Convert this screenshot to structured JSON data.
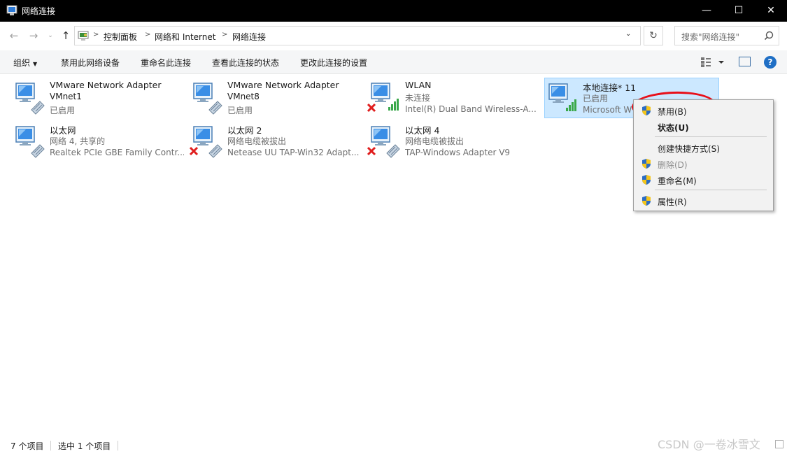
{
  "window": {
    "title": "网络连接",
    "minimize": "—",
    "maximize": "☐",
    "close": "✕"
  },
  "nav": {
    "back": "←",
    "forward": "→",
    "recent": "⌄",
    "up": "↑",
    "refresh": "↻",
    "dropdown": "⌄"
  },
  "breadcrumb": [
    "控制面板",
    "网络和 Internet",
    "网络连接"
  ],
  "breadcrumb_sep": ">",
  "search": {
    "placeholder": "搜索\"网络连接\""
  },
  "toolbar": {
    "organize": "组织",
    "disable_device": "禁用此网络设备",
    "rename": "重命名此连接",
    "view_status": "查看此连接的状态",
    "change_settings": "更改此连接的设置",
    "help": "?"
  },
  "connections": [
    {
      "name": "VMware Network Adapter",
      "line1": "VMnet1",
      "line2": "已启用",
      "icon": "ethernet-adapter-icon",
      "status": "enabled"
    },
    {
      "name": "VMware Network Adapter",
      "line1": "VMnet8",
      "line2": "已启用",
      "icon": "ethernet-adapter-icon",
      "status": "enabled"
    },
    {
      "name": "WLAN",
      "line1": "未连接",
      "line2": "Intel(R) Dual Band Wireless-A...",
      "icon": "wifi-adapter-icon",
      "status": "disconnected"
    },
    {
      "name": "本地连接* 11",
      "line1": "已启用",
      "line2": "Microsoft W",
      "icon": "wifi-adapter-icon",
      "status": "selected"
    },
    {
      "name": "以太网",
      "line1": "网络 4, 共享的",
      "line2": "Realtek PCIe GBE Family Contr...",
      "icon": "ethernet-adapter-icon",
      "status": "enabled"
    },
    {
      "name": "以太网 2",
      "line1": "网络电缆被拔出",
      "line2": "Netease UU TAP-Win32 Adapt...",
      "icon": "ethernet-adapter-icon",
      "status": "disconnected"
    },
    {
      "name": "以太网 4",
      "line1": "网络电缆被拔出",
      "line2": "TAP-Windows Adapter V9",
      "icon": "ethernet-adapter-icon",
      "status": "disconnected"
    }
  ],
  "context_menu": {
    "disable": "禁用(B)",
    "status": "状态(U)",
    "create_shortcut": "创建快捷方式(S)",
    "delete": "删除(D)",
    "rename": "重命名(M)",
    "properties": "属性(R)"
  },
  "statusbar": {
    "count": "7 个项目",
    "selected": "选中 1 个项目"
  },
  "watermark": "CSDN @一卷冰雪文",
  "colors": {
    "selection": "#cce8ff",
    "annotation": "#e8101a",
    "accent": "#1f6fc5"
  }
}
